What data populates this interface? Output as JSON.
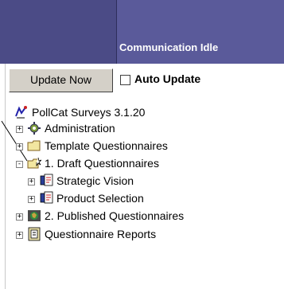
{
  "header": {
    "status": "Communication Idle"
  },
  "toolbar": {
    "update_now_label": "Update Now",
    "auto_update_label": "Auto Update",
    "auto_update_checked": false
  },
  "tree": {
    "root": {
      "label": "PollCat Surveys 3.1.20",
      "icon": "pollcat-icon"
    },
    "items": [
      {
        "label": "Administration",
        "icon": "admin-gear-icon",
        "expander": "+"
      },
      {
        "label": "Template Questionnaires",
        "icon": "folder-icon",
        "expander": "+"
      },
      {
        "label": "1. Draft Questionnaires",
        "icon": "draft-folder-icon",
        "expander": "-"
      },
      {
        "label": "Strategic Vision",
        "icon": "questionnaire-icon",
        "expander": "+"
      },
      {
        "label": "Product Selection",
        "icon": "questionnaire-icon",
        "expander": "+"
      },
      {
        "label": "2. Published Questionnaires",
        "icon": "published-globe-icon",
        "expander": "+"
      },
      {
        "label": "Questionnaire Reports",
        "icon": "reports-icon",
        "expander": "+"
      }
    ]
  },
  "colors": {
    "header_bg": "#4b4b86",
    "header_cell_bg": "#5a5a9a",
    "button_face": "#d4d0c8"
  }
}
